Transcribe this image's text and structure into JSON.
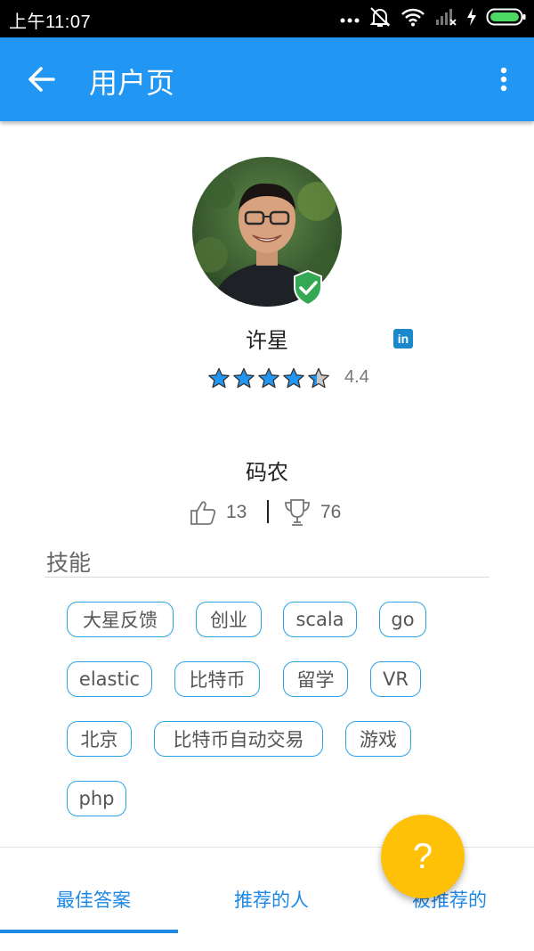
{
  "status_bar": {
    "time": "上午11:07",
    "icons": [
      "more-dots-icon",
      "mute-icon",
      "wifi-icon",
      "signal-icon",
      "charging-icon",
      "battery-icon"
    ]
  },
  "appbar": {
    "title": "用户页",
    "back_icon": "arrow-left-icon",
    "menu_icon": "more-vert-icon",
    "color": "#2196F3"
  },
  "profile": {
    "name": "许星",
    "linkedin_label": "in",
    "rating": 4.4,
    "rating_text": "4.4",
    "max_rating": 5,
    "title": "码农",
    "likes": "13",
    "trophies": "76"
  },
  "skills": {
    "heading": "技能",
    "tags": [
      "大星反馈",
      "创业",
      "scala",
      "go",
      "elastic",
      "比特币",
      "留学",
      "VR",
      "北京",
      "比特币自动交易",
      "游戏",
      "php"
    ]
  },
  "tabs": [
    {
      "label": "最佳答案",
      "selected": true
    },
    {
      "label": "推荐的人",
      "selected": false
    },
    {
      "label": "被推荐的",
      "selected": false
    }
  ],
  "fab": {
    "label": "?",
    "color": "#FFC107"
  },
  "accent_color": "#1e88e5"
}
